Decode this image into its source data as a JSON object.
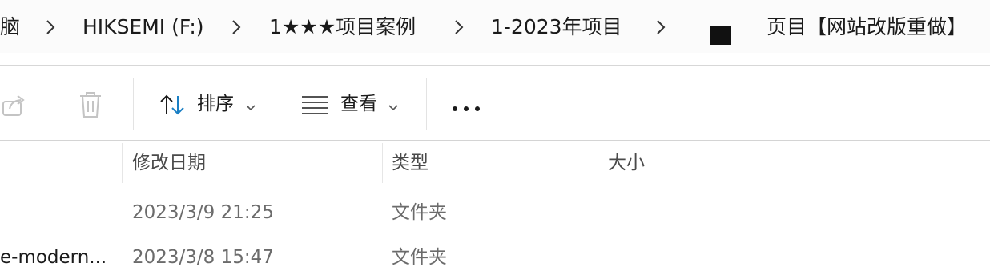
{
  "breadcrumb": {
    "items": [
      {
        "label": "脑"
      },
      {
        "label": "HIKSEMI (F:)"
      },
      {
        "label": "1★★★项目案例"
      },
      {
        "label": "1-2023年项目"
      },
      {
        "label": "页目【网站改版重做】"
      }
    ]
  },
  "toolbar": {
    "share_icon": "share-icon",
    "delete_icon": "trash-icon",
    "sort_label": "排序",
    "view_label": "查看",
    "more_label": "•••"
  },
  "file_list": {
    "columns": [
      {
        "label": "修改日期"
      },
      {
        "label": "类型"
      },
      {
        "label": "大小"
      }
    ],
    "rows": [
      {
        "name": "",
        "modified": "2023/3/9 21:25",
        "type": "文件夹",
        "size": ""
      },
      {
        "name": "e-modern...",
        "modified": "2023/3/8 15:47",
        "type": "文件夹",
        "size": ""
      }
    ]
  },
  "colors": {
    "address_bg": "#fbfbfb",
    "text": "#1a1a1a",
    "muted": "#6b6b6b",
    "accent": "#0067c0"
  }
}
